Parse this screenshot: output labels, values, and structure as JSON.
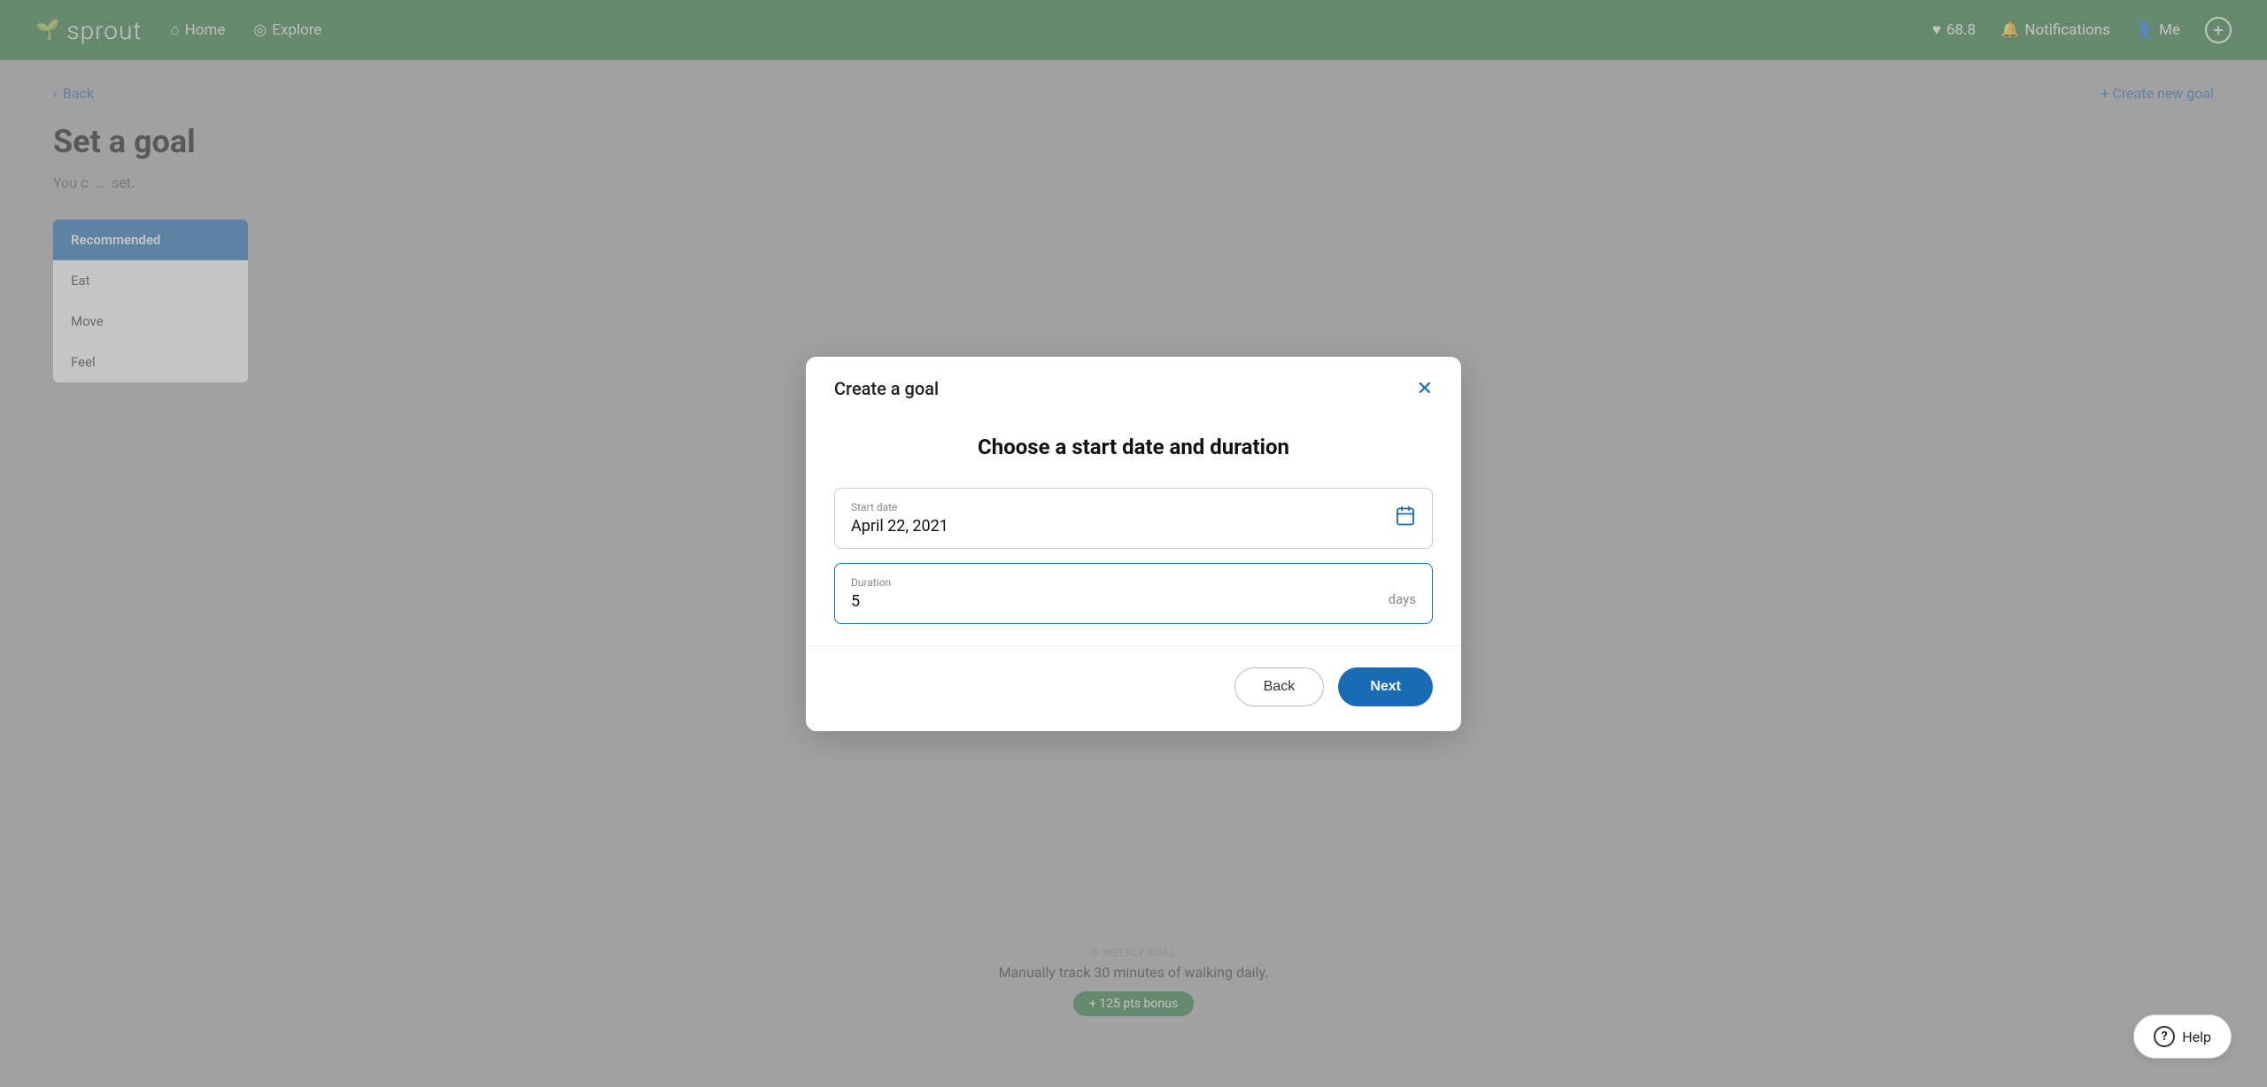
{
  "header": {
    "logo_text": "sprout",
    "nav_home": "Home",
    "nav_explore": "Explore",
    "score": "68.8",
    "notifications": "Notifications",
    "me": "Me"
  },
  "page": {
    "back_label": "Back",
    "title": "Set a goal",
    "create_goal_label": "Create new goal",
    "bg_text": "You c",
    "bg_text_end": "set."
  },
  "sidebar": {
    "items": [
      {
        "label": "Recommended"
      },
      {
        "label": "Eat"
      },
      {
        "label": "Move"
      },
      {
        "label": "Feel"
      }
    ]
  },
  "weekly_goal": {
    "section_label": "⟳ WEEKLY GOAL",
    "description": "Manually track 30 minutes of walking daily.",
    "pts_badge": "+ 125 pts bonus"
  },
  "modal": {
    "title": "Create a goal",
    "heading": "Choose a start date and duration",
    "start_date_label": "Start date",
    "start_date_value": "April 22, 2021",
    "duration_label": "Duration",
    "duration_value": "5",
    "duration_suffix": "days",
    "back_label": "Back",
    "next_label": "Next"
  },
  "help": {
    "label": "Help"
  }
}
